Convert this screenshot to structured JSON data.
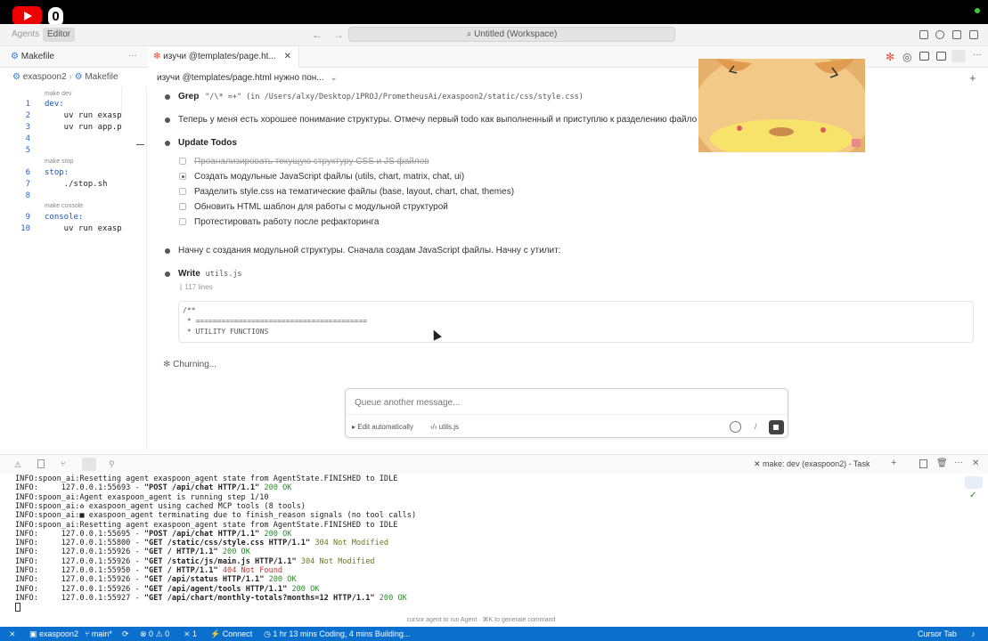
{
  "topbar": {
    "logo_text": "0"
  },
  "titlebar": {
    "tabs": [
      {
        "label": "Agents"
      },
      {
        "label": "Editor"
      }
    ],
    "search": "Untitled (Workspace)"
  },
  "editor_tabs": {
    "left_tab": "Makefile",
    "chat_tab": "изучи @templates/page.ht...",
    "breadcrumb_folder": "exaspoon2",
    "breadcrumb_file": "Makefile",
    "chat_title": "изучи @templates/page.html нужно пон..."
  },
  "makefile": {
    "lines": [
      {
        "n": "1",
        "text": "dev:"
      },
      {
        "n": "2",
        "text": "    uv run exasp"
      },
      {
        "n": "3",
        "text": "    uv run app.p"
      },
      {
        "n": "4",
        "text": ""
      },
      {
        "n": "5",
        "text": ""
      },
      {
        "n": "6",
        "text": "stop:"
      },
      {
        "n": "7",
        "text": "    ./stop.sh"
      },
      {
        "n": "8",
        "text": ""
      },
      {
        "n": "9",
        "text": "console:"
      },
      {
        "n": "10",
        "text": "    uv run exasp"
      }
    ],
    "codelens": [
      "make dev",
      "make stop",
      "make console"
    ]
  },
  "chat": {
    "grep_label": "Grep",
    "grep_args": "\"/\\* =+\" (in /Users/alxy/Desktop/1PROJ/PrometheusAi/exaspoon2/static/css/style.css)",
    "message1": "Теперь у меня есть хорошее понимание структуры. Отмечу первый todo как выполненный и приступлю к разделению файло",
    "todos_title": "Update Todos",
    "todos": [
      {
        "text": "Проанализировать текущую структуру CSS и JS файлов",
        "state": "done"
      },
      {
        "text": "Создать модульные JavaScript файлы (utils, chart, matrix, chat, ui)",
        "state": "active"
      },
      {
        "text": "Разделить style.css на тематические файлы (base, layout, chart, chat, themes)",
        "state": "pending"
      },
      {
        "text": "Обновить HTML шаблон для работы с модульной структурой",
        "state": "pending"
      },
      {
        "text": "Протестировать работу после рефакторинга",
        "state": "pending"
      }
    ],
    "message2": "Начну с создания модульной структуры. Сначала создам JavaScript файлы. Начну с утилит:",
    "write_label": "Write",
    "write_file": "utils.js",
    "write_lines": "117 lines",
    "code_lines": [
      "/**",
      " * ========================================",
      " * UTILITY FUNCTIONS"
    ],
    "status": "Churning...",
    "queue_placeholder": "Queue another message...",
    "edit_mode": "Edit automatically",
    "context_file": "utils.js",
    "slash": "/"
  },
  "terminal": {
    "task_label": "make: dev (exaspoon2) - Task",
    "lines": [
      [
        {
          "t": "INFO:spoon_ai:Resetting agent exaspoon_agent state from AgentState.FINISHED to IDLE",
          "c": ""
        }
      ],
      [
        {
          "t": "INFO:     127.0.0.1:55693 - ",
          "c": ""
        },
        {
          "t": "\"POST /api/chat HTTP/1.1\"",
          "c": "b"
        },
        {
          "t": " 200 OK",
          "c": "ok"
        }
      ],
      [
        {
          "t": "INFO:spoon_ai:Agent exaspoon_agent is running step 1/10",
          "c": ""
        }
      ],
      [
        {
          "t": "INFO:spoon_ai:♻ exaspoon_agent using cached MCP tools (8 tools)",
          "c": ""
        }
      ],
      [
        {
          "t": "INFO:spoon_ai:■ exaspoon_agent terminating due to finish_reason signals (no tool calls)",
          "c": ""
        }
      ],
      [
        {
          "t": "INFO:spoon_ai:Resetting agent exaspoon_agent state from AgentState.FINISHED to IDLE",
          "c": ""
        }
      ],
      [
        {
          "t": "INFO:     127.0.0.1:55695 - ",
          "c": ""
        },
        {
          "t": "\"POST /api/chat HTTP/1.1\"",
          "c": "b"
        },
        {
          "t": " 200 OK",
          "c": "ok"
        }
      ],
      [
        {
          "t": "INFO:     127.0.0.1:55800 - ",
          "c": ""
        },
        {
          "t": "\"GET /static/css/style.css HTTP/1.1\"",
          "c": "b"
        },
        {
          "t": " 304 Not Modified",
          "c": "nm"
        }
      ],
      [
        {
          "t": "INFO:     127.0.0.1:55926 - ",
          "c": ""
        },
        {
          "t": "\"GET / HTTP/1.1\"",
          "c": "b"
        },
        {
          "t": " 200 OK",
          "c": "ok"
        }
      ],
      [
        {
          "t": "INFO:     127.0.0.1:55926 - ",
          "c": ""
        },
        {
          "t": "\"GET /static/js/main.js HTTP/1.1\"",
          "c": "b"
        },
        {
          "t": " 304 Not Modified",
          "c": "nm"
        }
      ],
      [
        {
          "t": "INFO:     127.0.0.1:55950 - ",
          "c": ""
        },
        {
          "t": "\"GET / HTTP/1.1\"",
          "c": "b"
        },
        {
          "t": " 404 Not Found",
          "c": "nf"
        }
      ],
      [
        {
          "t": "INFO:     127.0.0.1:55926 - ",
          "c": ""
        },
        {
          "t": "\"GET /api/status HTTP/1.1\"",
          "c": "b"
        },
        {
          "t": " 200 OK",
          "c": "ok"
        }
      ],
      [
        {
          "t": "INFO:     127.0.0.1:55926 - ",
          "c": ""
        },
        {
          "t": "\"GET /api/agent/tools HTTP/1.1\"",
          "c": "b"
        },
        {
          "t": " 200 OK",
          "c": "ok"
        }
      ],
      [
        {
          "t": "INFO:     127.0.0.1:55927 - ",
          "c": ""
        },
        {
          "t": "\"GET /api/chart/monthly-totals?months=12 HTTP/1.1\"",
          "c": "b"
        },
        {
          "t": " 200 OK",
          "c": "ok"
        }
      ]
    ],
    "hint": "cursor  agent to run Agent · ⌘K to generate command"
  },
  "statusbar": {
    "folder": "exaspoon2",
    "branch": "main*",
    "errors": "0",
    "warnings": "0",
    "ports": "1",
    "connect": "Connect",
    "time": "1 hr 13 mins Coding, 4 mins Building...",
    "right": "Cursor Tab"
  },
  "colors": {
    "accent": "#0b6fce",
    "ok": "#2b8a2b",
    "not_found": "#cc3333",
    "tab_icon": "#e8523a"
  }
}
